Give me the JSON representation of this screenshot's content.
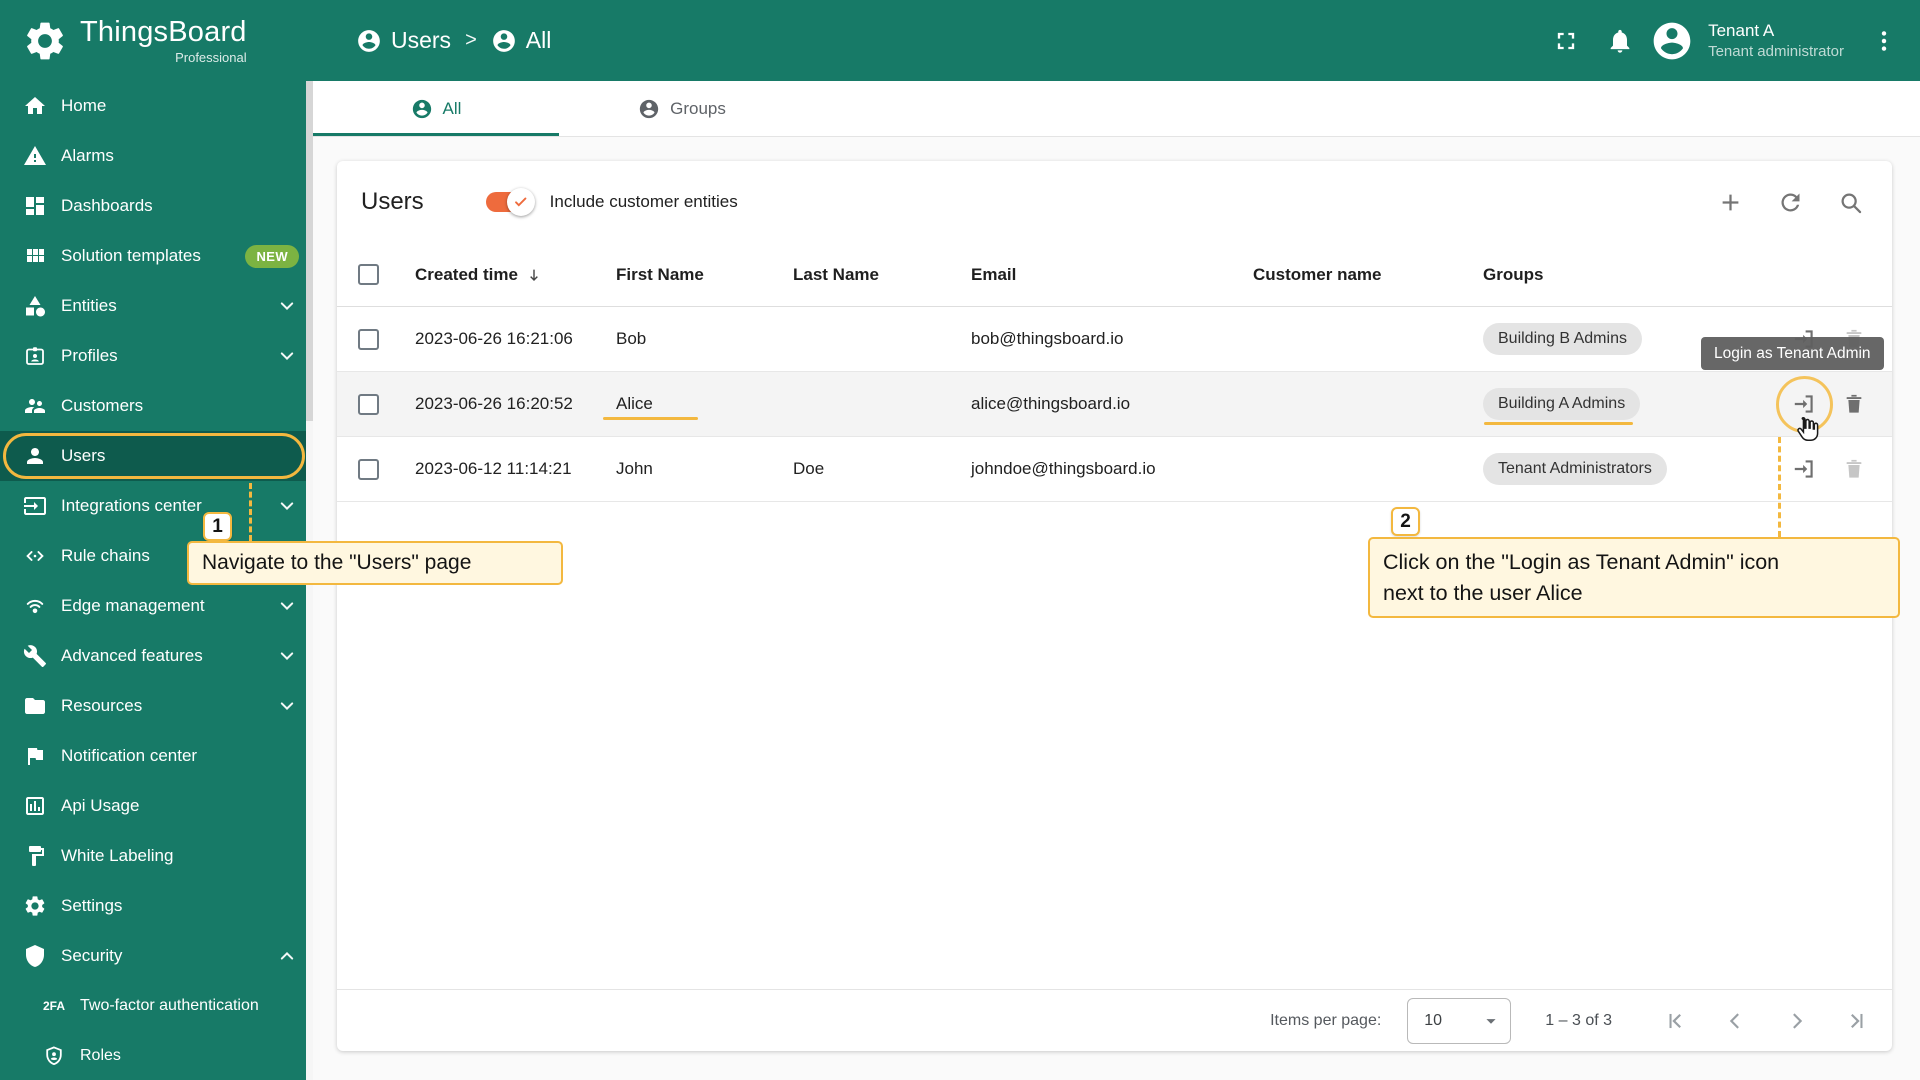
{
  "app": {
    "name": "ThingsBoard",
    "edition": "Professional"
  },
  "header": {
    "breadcrumb": [
      {
        "label": "Users",
        "icon": "person"
      },
      {
        "label": "All",
        "icon": "person"
      }
    ],
    "separator": ">",
    "tenant": {
      "name": "Tenant A",
      "role": "Tenant administrator"
    }
  },
  "tabs": [
    {
      "label": "All",
      "icon": "person",
      "active": true
    },
    {
      "label": "Groups",
      "icon": "person",
      "active": false
    }
  ],
  "sidebar": {
    "items": [
      {
        "label": "Home",
        "icon": "home"
      },
      {
        "label": "Alarms",
        "icon": "alarm"
      },
      {
        "label": "Dashboards",
        "icon": "dashboards"
      },
      {
        "label": "Solution templates",
        "icon": "templates",
        "badge": "NEW"
      },
      {
        "label": "Entities",
        "icon": "entities",
        "chevron": "down"
      },
      {
        "label": "Profiles",
        "icon": "profiles",
        "chevron": "down"
      },
      {
        "label": "Customers",
        "icon": "customers"
      },
      {
        "label": "Users",
        "icon": "users",
        "active": true
      },
      {
        "label": "Integrations center",
        "icon": "integrations",
        "chevron": "down"
      },
      {
        "label": "Rule chains",
        "icon": "rule-chains"
      },
      {
        "label": "Edge management",
        "icon": "edge",
        "chevron": "down"
      },
      {
        "label": "Advanced features",
        "icon": "advanced",
        "chevron": "down"
      },
      {
        "label": "Resources",
        "icon": "resources",
        "chevron": "down"
      },
      {
        "label": "Notification center",
        "icon": "notification"
      },
      {
        "label": "Api Usage",
        "icon": "api"
      },
      {
        "label": "White Labeling",
        "icon": "white-label"
      },
      {
        "label": "Settings",
        "icon": "settings"
      },
      {
        "label": "Security",
        "icon": "security",
        "chevron": "up"
      },
      {
        "label": "Two-factor authentication",
        "icon": "2fa",
        "sub": true
      },
      {
        "label": "Roles",
        "icon": "roles",
        "sub": true
      }
    ]
  },
  "table": {
    "title": "Users",
    "toggle_label": "Include customer entities",
    "toggle_on": true,
    "columns": [
      "Created time",
      "First Name",
      "Last Name",
      "Email",
      "Customer name",
      "Groups"
    ],
    "rows": [
      {
        "created": "2023-06-26 16:21:06",
        "first": "Bob",
        "last": "",
        "email": "bob@thingsboard.io",
        "customer": "",
        "group": "Building B Admins"
      },
      {
        "created": "2023-06-26 16:20:52",
        "first": "Alice",
        "last": "",
        "email": "alice@thingsboard.io",
        "customer": "",
        "group": "Building A Admins",
        "hover": true
      },
      {
        "created": "2023-06-12 11:14:21",
        "first": "John",
        "last": "Doe",
        "email": "johndoe@thingsboard.io",
        "customer": "",
        "group": "Tenant Administrators"
      }
    ]
  },
  "tooltip": {
    "text": "Login as Tenant Admin"
  },
  "annotations": {
    "step1": {
      "number": "1",
      "lines": [
        "Navigate to the \"Users\" page"
      ]
    },
    "step2": {
      "number": "2",
      "lines": [
        "Click on the \"Login as Tenant Admin\" icon",
        "next to the user Alice"
      ]
    }
  },
  "pagination": {
    "items_per_page_label": "Items per page:",
    "items_per_page": "10",
    "range": "1 – 3 of 3"
  },
  "colors": {
    "primary": "#177A67",
    "primary_dark": "#0E5B4D",
    "accent": "#F3B83F",
    "toggle": "#EE6B3D",
    "badge_new": "#7CB342",
    "tooltip_bg": "#5F5F5F"
  }
}
